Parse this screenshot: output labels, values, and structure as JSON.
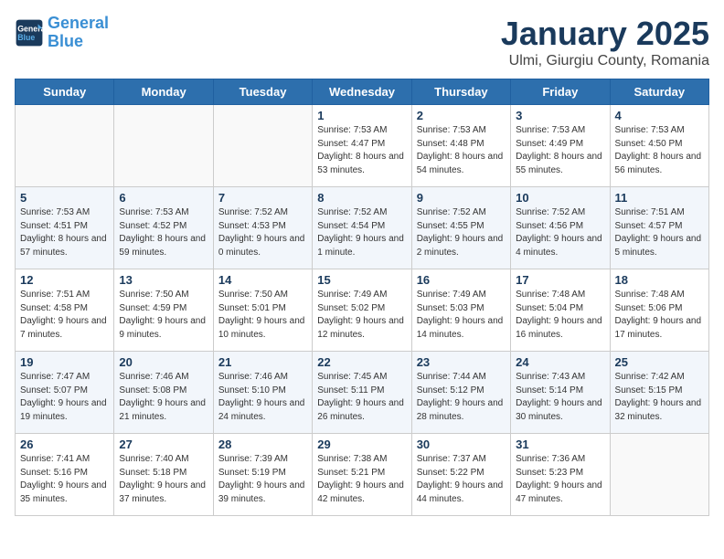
{
  "header": {
    "logo_line1": "General",
    "logo_line2": "Blue",
    "month": "January 2025",
    "location": "Ulmi, Giurgiu County, Romania"
  },
  "weekdays": [
    "Sunday",
    "Monday",
    "Tuesday",
    "Wednesday",
    "Thursday",
    "Friday",
    "Saturday"
  ],
  "weeks": [
    [
      {
        "day": "",
        "info": ""
      },
      {
        "day": "",
        "info": ""
      },
      {
        "day": "",
        "info": ""
      },
      {
        "day": "1",
        "info": "Sunrise: 7:53 AM\nSunset: 4:47 PM\nDaylight: 8 hours and 53 minutes."
      },
      {
        "day": "2",
        "info": "Sunrise: 7:53 AM\nSunset: 4:48 PM\nDaylight: 8 hours and 54 minutes."
      },
      {
        "day": "3",
        "info": "Sunrise: 7:53 AM\nSunset: 4:49 PM\nDaylight: 8 hours and 55 minutes."
      },
      {
        "day": "4",
        "info": "Sunrise: 7:53 AM\nSunset: 4:50 PM\nDaylight: 8 hours and 56 minutes."
      }
    ],
    [
      {
        "day": "5",
        "info": "Sunrise: 7:53 AM\nSunset: 4:51 PM\nDaylight: 8 hours and 57 minutes."
      },
      {
        "day": "6",
        "info": "Sunrise: 7:53 AM\nSunset: 4:52 PM\nDaylight: 8 hours and 59 minutes."
      },
      {
        "day": "7",
        "info": "Sunrise: 7:52 AM\nSunset: 4:53 PM\nDaylight: 9 hours and 0 minutes."
      },
      {
        "day": "8",
        "info": "Sunrise: 7:52 AM\nSunset: 4:54 PM\nDaylight: 9 hours and 1 minute."
      },
      {
        "day": "9",
        "info": "Sunrise: 7:52 AM\nSunset: 4:55 PM\nDaylight: 9 hours and 2 minutes."
      },
      {
        "day": "10",
        "info": "Sunrise: 7:52 AM\nSunset: 4:56 PM\nDaylight: 9 hours and 4 minutes."
      },
      {
        "day": "11",
        "info": "Sunrise: 7:51 AM\nSunset: 4:57 PM\nDaylight: 9 hours and 5 minutes."
      }
    ],
    [
      {
        "day": "12",
        "info": "Sunrise: 7:51 AM\nSunset: 4:58 PM\nDaylight: 9 hours and 7 minutes."
      },
      {
        "day": "13",
        "info": "Sunrise: 7:50 AM\nSunset: 4:59 PM\nDaylight: 9 hours and 9 minutes."
      },
      {
        "day": "14",
        "info": "Sunrise: 7:50 AM\nSunset: 5:01 PM\nDaylight: 9 hours and 10 minutes."
      },
      {
        "day": "15",
        "info": "Sunrise: 7:49 AM\nSunset: 5:02 PM\nDaylight: 9 hours and 12 minutes."
      },
      {
        "day": "16",
        "info": "Sunrise: 7:49 AM\nSunset: 5:03 PM\nDaylight: 9 hours and 14 minutes."
      },
      {
        "day": "17",
        "info": "Sunrise: 7:48 AM\nSunset: 5:04 PM\nDaylight: 9 hours and 16 minutes."
      },
      {
        "day": "18",
        "info": "Sunrise: 7:48 AM\nSunset: 5:06 PM\nDaylight: 9 hours and 17 minutes."
      }
    ],
    [
      {
        "day": "19",
        "info": "Sunrise: 7:47 AM\nSunset: 5:07 PM\nDaylight: 9 hours and 19 minutes."
      },
      {
        "day": "20",
        "info": "Sunrise: 7:46 AM\nSunset: 5:08 PM\nDaylight: 9 hours and 21 minutes."
      },
      {
        "day": "21",
        "info": "Sunrise: 7:46 AM\nSunset: 5:10 PM\nDaylight: 9 hours and 24 minutes."
      },
      {
        "day": "22",
        "info": "Sunrise: 7:45 AM\nSunset: 5:11 PM\nDaylight: 9 hours and 26 minutes."
      },
      {
        "day": "23",
        "info": "Sunrise: 7:44 AM\nSunset: 5:12 PM\nDaylight: 9 hours and 28 minutes."
      },
      {
        "day": "24",
        "info": "Sunrise: 7:43 AM\nSunset: 5:14 PM\nDaylight: 9 hours and 30 minutes."
      },
      {
        "day": "25",
        "info": "Sunrise: 7:42 AM\nSunset: 5:15 PM\nDaylight: 9 hours and 32 minutes."
      }
    ],
    [
      {
        "day": "26",
        "info": "Sunrise: 7:41 AM\nSunset: 5:16 PM\nDaylight: 9 hours and 35 minutes."
      },
      {
        "day": "27",
        "info": "Sunrise: 7:40 AM\nSunset: 5:18 PM\nDaylight: 9 hours and 37 minutes."
      },
      {
        "day": "28",
        "info": "Sunrise: 7:39 AM\nSunset: 5:19 PM\nDaylight: 9 hours and 39 minutes."
      },
      {
        "day": "29",
        "info": "Sunrise: 7:38 AM\nSunset: 5:21 PM\nDaylight: 9 hours and 42 minutes."
      },
      {
        "day": "30",
        "info": "Sunrise: 7:37 AM\nSunset: 5:22 PM\nDaylight: 9 hours and 44 minutes."
      },
      {
        "day": "31",
        "info": "Sunrise: 7:36 AM\nSunset: 5:23 PM\nDaylight: 9 hours and 47 minutes."
      },
      {
        "day": "",
        "info": ""
      }
    ]
  ]
}
